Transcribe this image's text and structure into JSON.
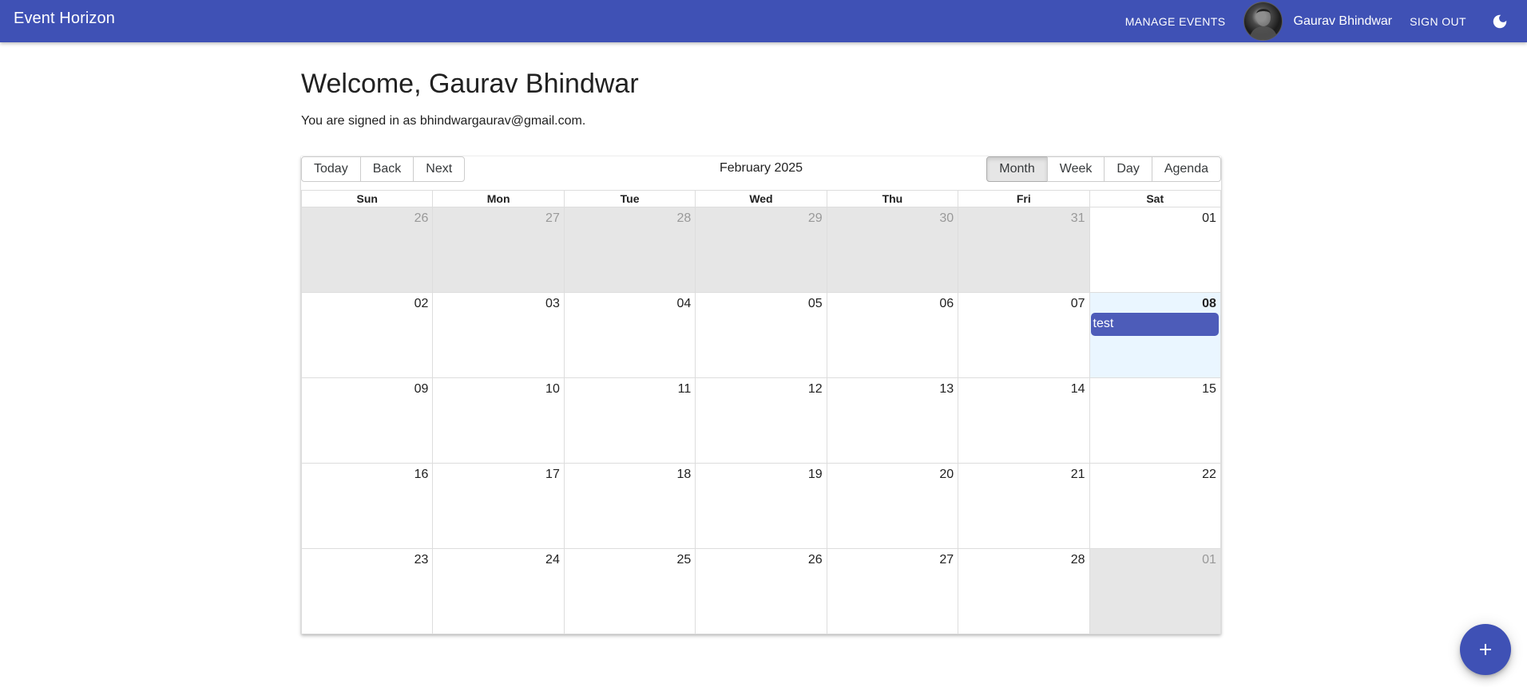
{
  "app": {
    "title": "Event Horizon"
  },
  "nav": {
    "manage_events": "MANAGE EVENTS",
    "user_name": "Gaurav Bhindwar",
    "sign_out": "SIGN OUT",
    "avatar_icon": "user-avatar",
    "theme_icon": "moon-icon"
  },
  "page": {
    "welcome": "Welcome, Gaurav Bhindwar",
    "signed_in": "You are signed in as bhindwargaurav@gmail.com."
  },
  "calendar": {
    "label": "February 2025",
    "nav_buttons": [
      "Today",
      "Back",
      "Next"
    ],
    "view_buttons": [
      "Month",
      "Week",
      "Day",
      "Agenda"
    ],
    "active_view": "Month",
    "weekdays": [
      "Sun",
      "Mon",
      "Tue",
      "Wed",
      "Thu",
      "Fri",
      "Sat"
    ],
    "weeks": [
      [
        {
          "date": "26",
          "off": true
        },
        {
          "date": "27",
          "off": true
        },
        {
          "date": "28",
          "off": true
        },
        {
          "date": "29",
          "off": true
        },
        {
          "date": "30",
          "off": true
        },
        {
          "date": "31",
          "off": true
        },
        {
          "date": "01"
        }
      ],
      [
        {
          "date": "02"
        },
        {
          "date": "03"
        },
        {
          "date": "04"
        },
        {
          "date": "05"
        },
        {
          "date": "06"
        },
        {
          "date": "07"
        },
        {
          "date": "08",
          "today": true,
          "events": [
            "test"
          ]
        }
      ],
      [
        {
          "date": "09"
        },
        {
          "date": "10"
        },
        {
          "date": "11"
        },
        {
          "date": "12"
        },
        {
          "date": "13"
        },
        {
          "date": "14"
        },
        {
          "date": "15"
        }
      ],
      [
        {
          "date": "16"
        },
        {
          "date": "17"
        },
        {
          "date": "18"
        },
        {
          "date": "19"
        },
        {
          "date": "20"
        },
        {
          "date": "21"
        },
        {
          "date": "22"
        }
      ],
      [
        {
          "date": "23"
        },
        {
          "date": "24"
        },
        {
          "date": "25"
        },
        {
          "date": "26"
        },
        {
          "date": "27"
        },
        {
          "date": "28"
        },
        {
          "date": "01",
          "off": true
        }
      ]
    ]
  },
  "fab": {
    "icon": "plus-icon"
  },
  "colors": {
    "primary": "#3f51b5",
    "event": "#4d5cb9",
    "today_bg": "#eaf6ff",
    "off_range_bg": "#e6e6e6"
  }
}
